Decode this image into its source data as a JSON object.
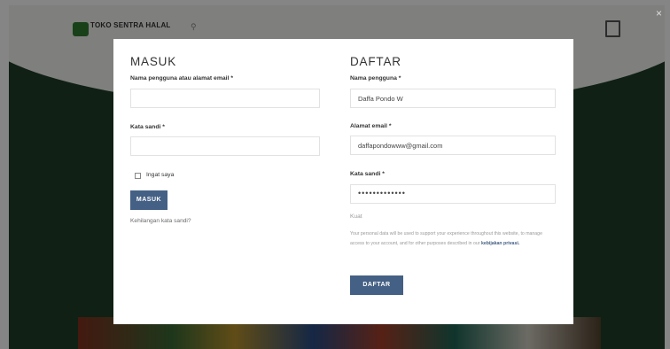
{
  "site": {
    "name": "TOKO SENTRA HALAL"
  },
  "modal": {
    "login": {
      "title": "MASUK",
      "username_label": "Nama pengguna atau alamat email *",
      "username_value": "",
      "password_label": "Kata sandi *",
      "password_value": "",
      "remember_label": "Ingat saya",
      "submit_label": "MASUK",
      "lost_password_link": "Kehilangan kata sandi?"
    },
    "register": {
      "title": "DAFTAR",
      "username_label": "Nama pengguna *",
      "username_value": "Daffa Pondo W",
      "email_label": "Alamat email *",
      "email_value": "daffapondowww@gmail.com",
      "password_label": "Kata sandi *",
      "password_value": "•••••••••••••",
      "strength_text": "Kuat",
      "privacy_text": "Your personal data will be used to support your experience throughout this website, to manage access to your account, and for other purposes described in our",
      "privacy_link": "kebijakan privasi.",
      "submit_label": "DAFTAR"
    }
  },
  "colors": {
    "accent": "#446084",
    "brand": "#2e7d32"
  },
  "icons": {
    "cart": "cart-icon",
    "search": "search-icon",
    "close": "close-icon",
    "logo": "logo-icon"
  }
}
